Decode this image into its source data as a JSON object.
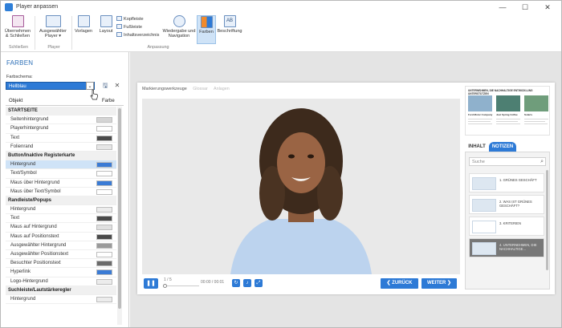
{
  "window": {
    "title": "Player anpassen",
    "controls": [
      "—",
      "☐",
      "✕"
    ]
  },
  "ribbon": {
    "groups": [
      {
        "label": "Schließen",
        "buttons": [
          {
            "label": "Übernehmen & Schließen",
            "icon": "save-close-icon"
          }
        ]
      },
      {
        "label": "Player",
        "buttons": [
          {
            "label": "Ausgewählter Player ▾",
            "icon": "player-icon"
          }
        ]
      },
      {
        "label": "Anpassung",
        "buttons": [
          {
            "label": "Vorlagen",
            "icon": "templates-icon"
          },
          {
            "label": "Layout",
            "icon": "layout-icon"
          },
          {
            "label": "Wiedergabe und Navigation",
            "icon": "compass-icon"
          },
          {
            "label": "Farben",
            "icon": "colors-icon",
            "active": true
          },
          {
            "label": "Beschriftung",
            "icon": "text-icon"
          }
        ]
      }
    ],
    "small_buttons": [
      "Kopfleiste",
      "Fußleiste",
      "Inhaltsverzeichnis"
    ],
    "group_labels": {
      "close": "Schließen",
      "player": "Player",
      "customize": "Anpassung"
    },
    "btn": {
      "apply_close": "Übernehmen & Schließen",
      "selected_player": "Ausgewählter Player ▾",
      "templates": "Vorlagen",
      "layout": "Layout",
      "header": "Kopfleiste",
      "footer": "Fußleiste",
      "toc": "Inhaltsverzeichnis",
      "playback": "Wiedergabe und Navigation",
      "colors": "Farben",
      "labels": "Beschriftung"
    }
  },
  "panel": {
    "heading": "FARBEN",
    "scheme_label": "Farbschema:",
    "scheme_value": "Hellblau",
    "col_object": "Objekt",
    "col_color": "Farbe",
    "rows": [
      {
        "type": "section",
        "label": "STARTSEITE"
      },
      {
        "label": "Seitenhintergrund",
        "color": "#d4d4d4"
      },
      {
        "label": "Playerhintergrund",
        "color": "#ffffff"
      },
      {
        "label": "Text",
        "color": "#4a4a4a"
      },
      {
        "label": "Folienrand",
        "color": "#e6e6e6"
      },
      {
        "type": "section",
        "label": "Button/Inaktive Registerkarte"
      },
      {
        "label": "Hintergrund",
        "color": "#3a7bd5",
        "selected": true
      },
      {
        "label": "Text/Symbol",
        "color": "#ffffff"
      },
      {
        "label": "Maus über Hintergrund",
        "color": "#3a7bd5"
      },
      {
        "label": "Maus über Text/Symbol",
        "color": "#ffffff"
      },
      {
        "type": "section",
        "label": "Randleiste/Popups"
      },
      {
        "label": "Hintergrund",
        "color": "#ececec"
      },
      {
        "label": "Text",
        "color": "#4a4a4a"
      },
      {
        "label": "Maus auf Hintergrund",
        "color": "#e0e0e0"
      },
      {
        "label": "Maus auf Positionstext",
        "color": "#4a4a4a"
      },
      {
        "label": "Ausgewählter Hintergrund",
        "color": "#9a9a9a"
      },
      {
        "label": "Ausgewählter Positionstext",
        "color": "#ffffff"
      },
      {
        "label": "Besuchter Positionstext",
        "color": "#6a6a6a"
      },
      {
        "label": "Hyperlink",
        "color": "#3a7bd5"
      },
      {
        "label": "Logo-Hintergrund",
        "color": "#ececec"
      },
      {
        "type": "section",
        "label": "Suchleiste/Lautstärkeregler"
      },
      {
        "label": "Hintergrund",
        "color": "#ececec"
      }
    ]
  },
  "player": {
    "tabs": [
      "Markierungswerkzeuge",
      "Glossar",
      "Anlagen"
    ],
    "slide_counter": "1 / 5",
    "time": "00:00 / 00:01",
    "back_label": "❮ ZURÜCK",
    "next_label": "WEITER ❯",
    "sidebar": {
      "doc_title": "UNTERNEHMEN, DIE NACHHALTIGE ENTWICKLUNG UNTERSTÜTZEN",
      "doc_captions": [
        "Ford Motor Company",
        "Just Spring Coffee",
        "Solaris"
      ],
      "tab_contents": "INHALT",
      "tab_notes": "NOTIZEN",
      "search_placeholder": "Suche",
      "chapters": [
        {
          "title": "1. GRÜNES GESCHÄFT"
        },
        {
          "title": "2. WAS IST GRÜNES GESCHÄFT?"
        },
        {
          "title": "3. KRITERIEN"
        },
        {
          "title": "4. UNTERNEHMEN, DIE NACHHALTIGE...",
          "selected": true
        }
      ]
    }
  },
  "colors": {
    "accent": "#2d7ad6",
    "selected_row": "#cfe3f7",
    "stage_bg": "#e4e4e4"
  }
}
